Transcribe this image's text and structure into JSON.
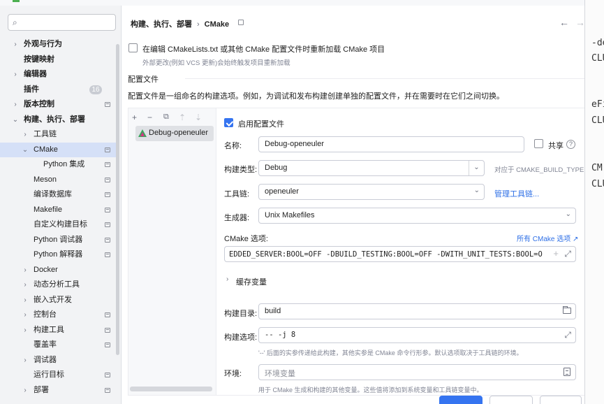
{
  "nav": {
    "search_placeholder": "",
    "items": [
      {
        "label": "外观与行为",
        "chev": "›",
        "bold": true,
        "indent": 0
      },
      {
        "label": "按键映射",
        "chev": "",
        "bold": true,
        "indent": 0
      },
      {
        "label": "编辑器",
        "chev": "›",
        "bold": true,
        "indent": 0
      },
      {
        "label": "插件",
        "chev": "",
        "bold": true,
        "indent": 0,
        "badge": "16"
      },
      {
        "label": "版本控制",
        "chev": "›",
        "bold": true,
        "indent": 0,
        "page": true
      },
      {
        "label": "构建、执行、部署",
        "chev": "⌄",
        "bold": true,
        "indent": 0
      },
      {
        "label": "工具链",
        "chev": "›",
        "bold": false,
        "indent": 1
      },
      {
        "label": "CMake",
        "chev": "⌄",
        "bold": false,
        "indent": 1,
        "page": true,
        "selected": true
      },
      {
        "label": "Python 集成",
        "chev": "",
        "bold": false,
        "indent": 2,
        "page": true
      },
      {
        "label": "Meson",
        "chev": "",
        "bold": false,
        "indent": 1,
        "page": true
      },
      {
        "label": "编译数据库",
        "chev": "",
        "bold": false,
        "indent": 1,
        "page": true
      },
      {
        "label": "Makefile",
        "chev": "",
        "bold": false,
        "indent": 1,
        "page": true
      },
      {
        "label": "自定义构建目标",
        "chev": "",
        "bold": false,
        "indent": 1,
        "page": true
      },
      {
        "label": "Python 调试器",
        "chev": "",
        "bold": false,
        "indent": 1,
        "page": true
      },
      {
        "label": "Python 解释器",
        "chev": "",
        "bold": false,
        "indent": 1,
        "page": true
      },
      {
        "label": "Docker",
        "chev": "›",
        "bold": false,
        "indent": 1
      },
      {
        "label": "动态分析工具",
        "chev": "›",
        "bold": false,
        "indent": 1
      },
      {
        "label": "嵌入式开发",
        "chev": "›",
        "bold": false,
        "indent": 1
      },
      {
        "label": "控制台",
        "chev": "›",
        "bold": false,
        "indent": 1,
        "page": true
      },
      {
        "label": "构建工具",
        "chev": "›",
        "bold": false,
        "indent": 1,
        "page": true
      },
      {
        "label": "覆盖率",
        "chev": "",
        "bold": false,
        "indent": 1,
        "page": true
      },
      {
        "label": "调试器",
        "chev": "›",
        "bold": false,
        "indent": 1
      },
      {
        "label": "运行目标",
        "chev": "",
        "bold": false,
        "indent": 1,
        "page": true
      },
      {
        "label": "部署",
        "chev": "›",
        "bold": false,
        "indent": 1,
        "page": true
      }
    ]
  },
  "breadcrumb": {
    "parent": "构建、执行、部署",
    "sep": "›",
    "current": "CMake"
  },
  "reload": {
    "label": "在编辑 CMakeLists.txt 或其他 CMake 配置文件时重新加载 CMake 项目",
    "hint": "外部更改(例如 VCS 更新)会始终触发项目重新加载",
    "checked": false
  },
  "profiles_section": {
    "title": "配置文件",
    "description": "配置文件是一组命名的构建选项。例如，为调试和发布构建创建单独的配置文件，并在需要时在它们之间切换。"
  },
  "toolbar": {
    "add": "+",
    "remove": "−",
    "copy": "⧉",
    "up": "⇡",
    "down": "⇣"
  },
  "profile_list": [
    {
      "name": "Debug-openeuler"
    }
  ],
  "profile": {
    "enable_label": "启用配置文件",
    "enabled": true,
    "name_label": "名称:",
    "name_value": "Debug-openeuler",
    "share_label": "共享",
    "build_type_label": "构建类型:",
    "build_type_value": "Debug",
    "build_type_hint": "对应于 CMAKE_BUILD_TYPE",
    "toolchain_label": "工具链:",
    "toolchain_value": "openeuler",
    "manage_toolchains": "管理工具链...",
    "generator_label": "生成器:",
    "generator_value": "Unix Makefiles",
    "cmake_options_label": "CMake 选项:",
    "all_cmake_options": "所有 CMake 选项 ↗",
    "cmake_options_value": "EDDED_SERVER:BOOL=OFF -DBUILD_TESTING:BOOL=OFF -DWITH_UNIT_TESTS:BOOL=OFF",
    "cache_vars_label": "缓存变量",
    "build_dir_label": "构建目录:",
    "build_dir_value": "build",
    "build_opts_label": "构建选项:",
    "build_opts_value": "-- -j 8",
    "build_opts_hint": "'--' 后面的实参传递给此构建，其他实参是 CMake 命令行形参。默认选项取决于工具链的环境。",
    "env_label": "环境:",
    "env_placeholder": "环境变量",
    "env_hint": "用于 CMake 生成和构建的其他变量。这些值将添加到系统变量和工具链变量中。"
  },
  "bg_editor": {
    "lines": [
      "-de",
      "CLU",
      "eFi",
      "CLU",
      "CM",
      "CLU"
    ]
  },
  "colors": {
    "accent": "#3574f0",
    "link": "#2e6fe6",
    "selection": "#d5e0f7"
  }
}
